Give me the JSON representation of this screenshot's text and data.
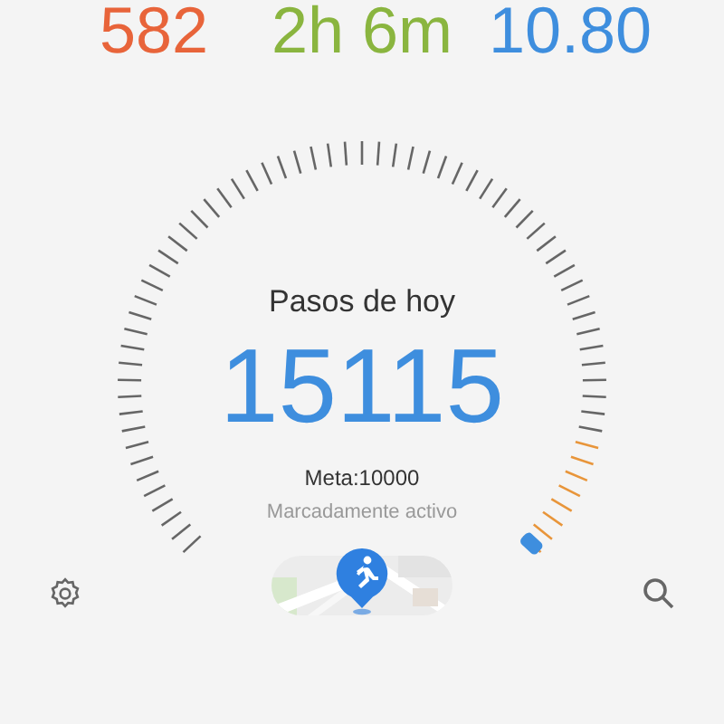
{
  "stats": [
    {
      "value": "582",
      "color": "#e8643a"
    },
    {
      "value": "2h 6m",
      "color": "#8ab53f"
    },
    {
      "value": "10.80",
      "color": "#3e8ede"
    }
  ],
  "gauge": {
    "title": "Pasos de hoy",
    "steps": "15115",
    "goal": "Meta:10000",
    "activity": "Marcadamente activo"
  }
}
